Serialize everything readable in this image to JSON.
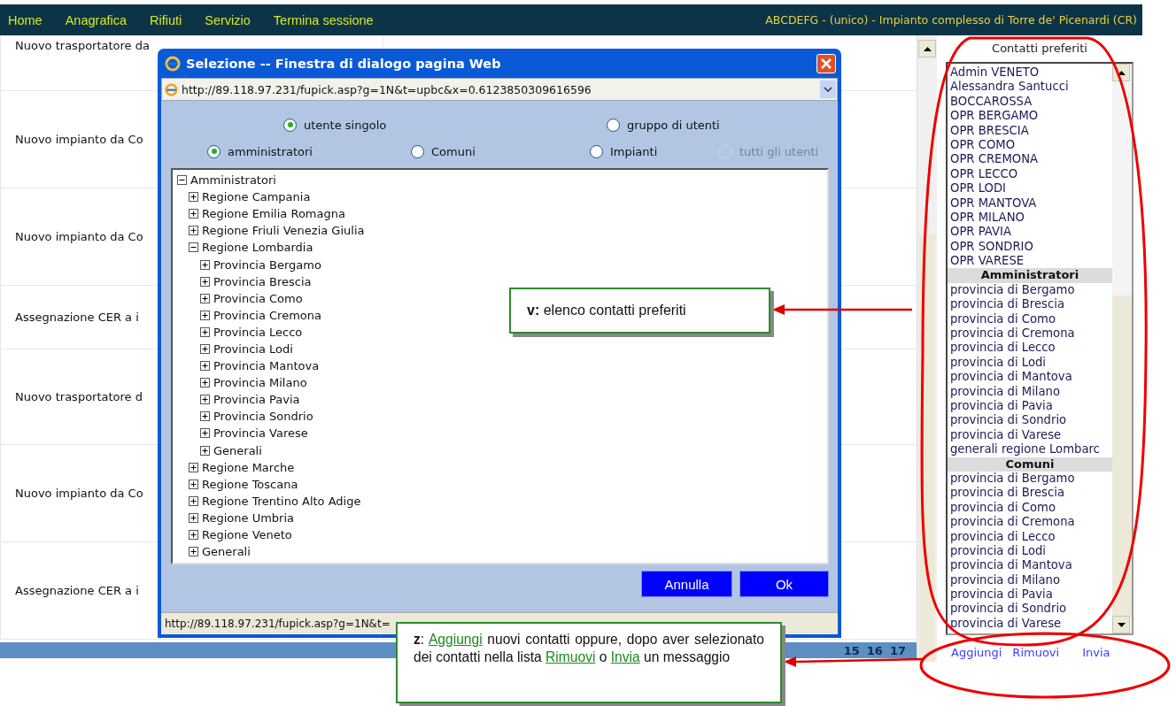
{
  "nav": {
    "items": [
      "Home",
      "Anagrafica",
      "Rifiuti",
      "Servizio",
      "Termina sessione"
    ],
    "site_info": "ABCDEFG - (unico) - Impianto complesso di Torre de' Picenardi (CR)"
  },
  "messages": [
    {
      "subject": "Nuovo trasportatore da"
    },
    {
      "subject": "Nuovo impianto da Co"
    },
    {
      "subject": "Nuovo impianto da Co"
    },
    {
      "subject": "Assegnazione CER a i"
    },
    {
      "subject": "Nuovo trasportatore d"
    },
    {
      "subject": "Nuovo impianto da Co"
    },
    {
      "subject": "Assegnazione CER a i"
    }
  ],
  "pagination": [
    "15",
    "16",
    "17"
  ],
  "favorites": {
    "title": "Contatti preferiti",
    "items": [
      {
        "kind": "item",
        "text": "Admin VENETO"
      },
      {
        "kind": "item",
        "text": "Alessandra Santucci"
      },
      {
        "kind": "item",
        "text": "BOCCAROSSA"
      },
      {
        "kind": "item",
        "text": "OPR BERGAMO"
      },
      {
        "kind": "item",
        "text": "OPR BRESCIA"
      },
      {
        "kind": "item",
        "text": "OPR COMO"
      },
      {
        "kind": "item",
        "text": "OPR CREMONA"
      },
      {
        "kind": "item",
        "text": "OPR LECCO"
      },
      {
        "kind": "item",
        "text": "OPR LODI"
      },
      {
        "kind": "item",
        "text": "OPR MANTOVA"
      },
      {
        "kind": "item",
        "text": "OPR MILANO"
      },
      {
        "kind": "item",
        "text": "OPR PAVIA"
      },
      {
        "kind": "item",
        "text": "OPR SONDRIO"
      },
      {
        "kind": "item",
        "text": "OPR VARESE"
      },
      {
        "kind": "header",
        "text": "Amministratori"
      },
      {
        "kind": "item",
        "text": "provincia di Bergamo"
      },
      {
        "kind": "item",
        "text": "provincia di Brescia"
      },
      {
        "kind": "item",
        "text": "provincia di Como"
      },
      {
        "kind": "item",
        "text": "provincia di Cremona"
      },
      {
        "kind": "item",
        "text": "provincia di Lecco"
      },
      {
        "kind": "item",
        "text": "provincia di Lodi"
      },
      {
        "kind": "item",
        "text": "provincia di Mantova"
      },
      {
        "kind": "item",
        "text": "provincia di Milano"
      },
      {
        "kind": "item",
        "text": "provincia di Pavia"
      },
      {
        "kind": "item",
        "text": "provincia di Sondrio"
      },
      {
        "kind": "item",
        "text": "provincia di Varese"
      },
      {
        "kind": "item",
        "text": "generali regione Lombarc"
      },
      {
        "kind": "header",
        "text": "Comuni"
      },
      {
        "kind": "item",
        "text": "provincia di Bergamo"
      },
      {
        "kind": "item",
        "text": "provincia di Brescia"
      },
      {
        "kind": "item",
        "text": "provincia di Como"
      },
      {
        "kind": "item",
        "text": "provincia di Cremona"
      },
      {
        "kind": "item",
        "text": "provincia di Lecco"
      },
      {
        "kind": "item",
        "text": "provincia di Lodi"
      },
      {
        "kind": "item",
        "text": "provincia di Mantova"
      },
      {
        "kind": "item",
        "text": "provincia di Milano"
      },
      {
        "kind": "item",
        "text": "provincia di Pavia"
      },
      {
        "kind": "item",
        "text": "provincia di Sondrio"
      },
      {
        "kind": "item",
        "text": "provincia di Varese"
      }
    ],
    "actions": [
      "Aggiungi",
      "Rimuovi",
      "Invia"
    ]
  },
  "dialog": {
    "title": "Selezione -- Finestra di dialogo pagina Web",
    "address": "http://89.118.97.231/fupick.asp?g=1N&t=upbc&x=0.6123850309616596",
    "scope_options": [
      {
        "label": "utente singolo",
        "selected": true,
        "disabled": false
      },
      {
        "label": "gruppo di utenti",
        "selected": false,
        "disabled": false
      }
    ],
    "group_options": [
      {
        "label": "amministratori",
        "selected": true,
        "disabled": false
      },
      {
        "label": "Comuni",
        "selected": false,
        "disabled": false
      },
      {
        "label": "Impianti",
        "selected": false,
        "disabled": false
      },
      {
        "label": "tutti gli utenti",
        "selected": false,
        "disabled": true
      }
    ],
    "tree": [
      {
        "label": "Amministratori",
        "expanded": true,
        "children": [
          {
            "label": "Regione Campania",
            "expanded": false
          },
          {
            "label": "Regione Emilia Romagna",
            "expanded": false
          },
          {
            "label": "Regione Friuli Venezia Giulia",
            "expanded": false
          },
          {
            "label": "Regione Lombardia",
            "expanded": true,
            "children": [
              {
                "label": "Provincia Bergamo",
                "expanded": false
              },
              {
                "label": "Provincia Brescia",
                "expanded": false
              },
              {
                "label": "Provincia Como",
                "expanded": false
              },
              {
                "label": "Provincia Cremona",
                "expanded": false
              },
              {
                "label": "Provincia Lecco",
                "expanded": false
              },
              {
                "label": "Provincia Lodi",
                "expanded": false
              },
              {
                "label": "Provincia Mantova",
                "expanded": false
              },
              {
                "label": "Provincia Milano",
                "expanded": false
              },
              {
                "label": "Provincia Pavia",
                "expanded": false
              },
              {
                "label": "Provincia Sondrio",
                "expanded": false
              },
              {
                "label": "Provincia Varese",
                "expanded": false
              },
              {
                "label": "Generali",
                "expanded": false
              }
            ]
          },
          {
            "label": "Regione Marche",
            "expanded": false
          },
          {
            "label": "Regione Toscana",
            "expanded": false
          },
          {
            "label": "Regione Trentino Alto Adige",
            "expanded": false
          },
          {
            "label": "Regione Umbria",
            "expanded": false
          },
          {
            "label": "Regione Veneto",
            "expanded": false
          },
          {
            "label": "Generali",
            "expanded": false
          }
        ]
      }
    ],
    "buttons": [
      "Annulla",
      "Ok"
    ],
    "status_url": "http://89.118.97.231/fupick.asp?g=1N&t="
  },
  "callouts": [
    {
      "segments": [
        {
          "kind": "plain",
          "text": "**v:** elenco contatti preferiti"
        }
      ]
    },
    {
      "segments": [
        {
          "kind": "plain",
          "text": "**z**: "
        },
        {
          "kind": "link",
          "text": "Aggiungi"
        },
        {
          "kind": "plain",
          "text": " nuovi contatti oppure, dopo aver selezionato dei contatti nella lista "
        },
        {
          "kind": "link",
          "text": "Rimuovi"
        },
        {
          "kind": "plain",
          "text": " o "
        },
        {
          "kind": "link",
          "text": "Invia"
        },
        {
          "kind": "plain",
          "text": " un messaggio"
        }
      ]
    }
  ]
}
